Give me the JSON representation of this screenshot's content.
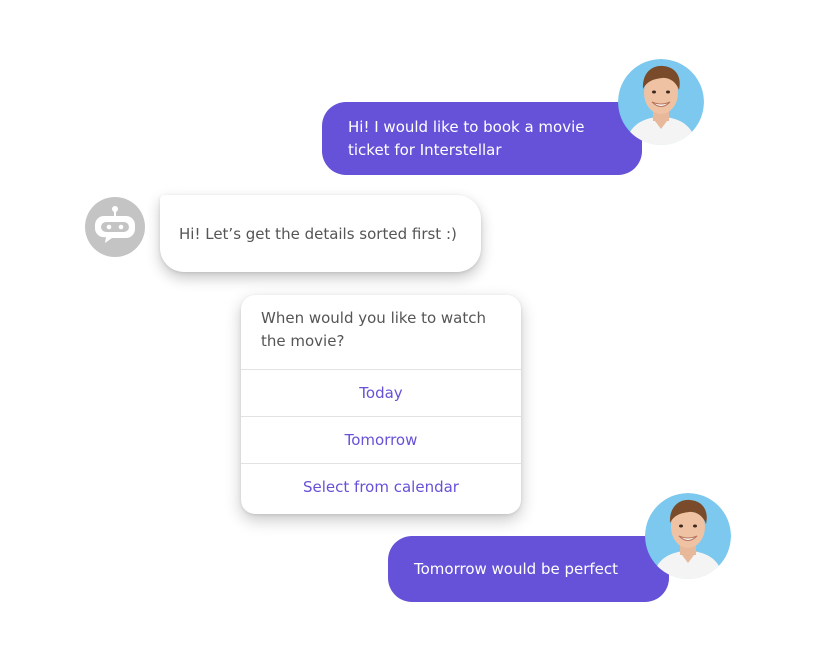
{
  "colors": {
    "accent": "#6552d8",
    "bot_avatar_bg": "#c4c4c4",
    "user_avatar_bg": "#7cc8ee",
    "text_muted": "#555555"
  },
  "messages": {
    "user_1": "Hi! I would like to book a movie ticket for Interstellar",
    "bot_1": "Hi! Let’s get the details sorted first :)",
    "user_2": "Tomorrow would be perfect"
  },
  "question_card": {
    "question": "When would you like to watch the movie?",
    "options": [
      "Today",
      "Tomorrow",
      "Select from calendar"
    ]
  },
  "icons": {
    "bot_avatar": "robot-chat-icon",
    "user_avatar": "user-avatar-photo"
  }
}
